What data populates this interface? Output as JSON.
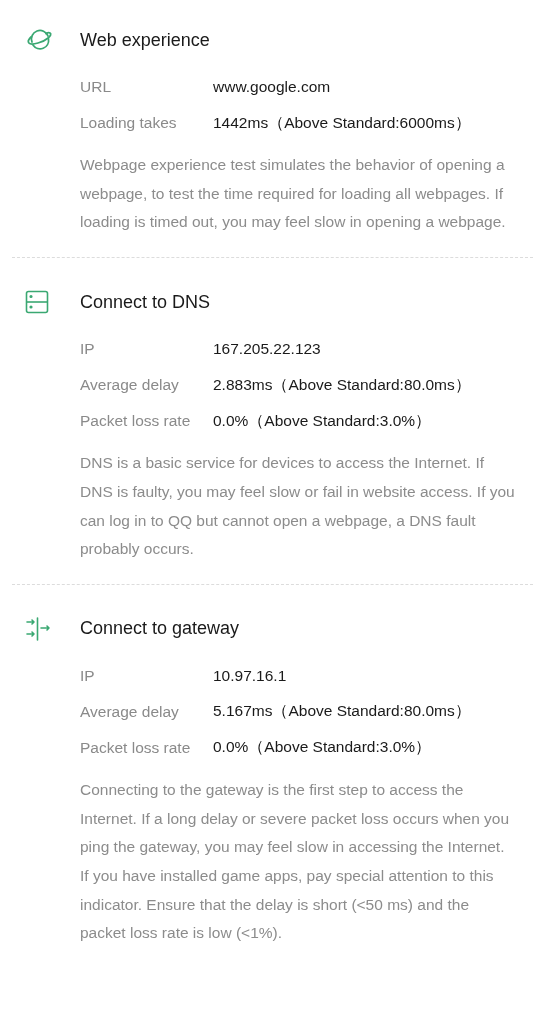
{
  "sections": [
    {
      "kind": "globe",
      "title": "Web experience",
      "rows": [
        {
          "label": "URL",
          "value": "www.google.com"
        },
        {
          "label": "Loading takes",
          "value": "1442ms（Above Standard:6000ms）"
        }
      ],
      "description": "Webpage experience test simulates the behavior of opening a webpage, to test the time required for loading all webpages. If loading is timed out, you may feel slow in opening a webpage."
    },
    {
      "kind": "server",
      "title": "Connect to DNS",
      "rows": [
        {
          "label": "IP",
          "value": "167.205.22.123"
        },
        {
          "label": "Average delay",
          "value": "2.883ms（Above Standard:80.0ms）"
        },
        {
          "label": "Packet loss rate",
          "value": "0.0%（Above Standard:3.0%）"
        }
      ],
      "description": "DNS is a basic service for devices to access the Internet. If DNS is faulty, you may feel slow or fail in website access. If you can log in to QQ but cannot open a webpage, a DNS fault probably occurs."
    },
    {
      "kind": "gateway",
      "title": "Connect to gateway",
      "rows": [
        {
          "label": "IP",
          "value": "10.97.16.1"
        },
        {
          "label": "Average delay",
          "value": "5.167ms（Above Standard:80.0ms）"
        },
        {
          "label": "Packet loss rate",
          "value": "0.0%（Above Standard:3.0%）"
        }
      ],
      "description": "Connecting to the gateway is the first step to access the Internet. If a long delay or severe packet loss occurs when you ping the gateway, you may feel slow in accessing the Internet. If you have installed game apps, pay special attention to this indicator. Ensure that the delay is short (<50 ms) and the packet loss rate is low (<1%)."
    }
  ]
}
